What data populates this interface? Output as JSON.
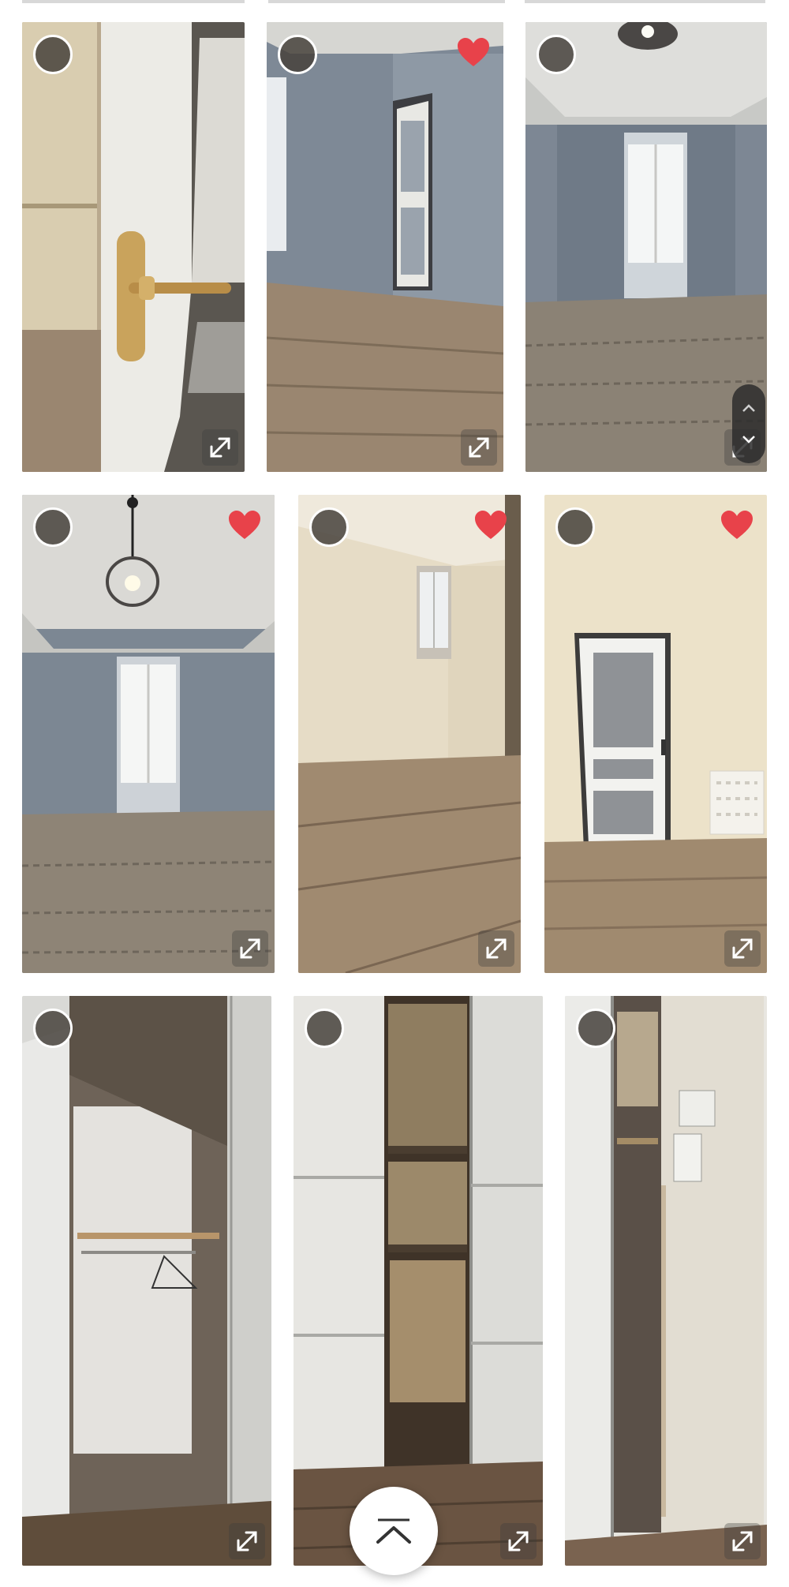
{
  "gallery": {
    "rows": [
      {
        "tiles": [
          {
            "scene": "door-handle",
            "favorited": false
          },
          {
            "scene": "room-door",
            "favorited": true
          },
          {
            "scene": "room-window",
            "favorited": false
          }
        ]
      },
      {
        "tiles": [
          {
            "scene": "room-lamp",
            "favorited": true
          },
          {
            "scene": "room-corner",
            "favorited": true
          },
          {
            "scene": "white-door",
            "favorited": true
          }
        ]
      },
      {
        "tiles": [
          {
            "scene": "closet-shelf",
            "favorited": false
          },
          {
            "scene": "closet-open",
            "favorited": false
          },
          {
            "scene": "closet-narrow",
            "favorited": false
          }
        ]
      }
    ]
  },
  "icons": {
    "select": "selection-circle-icon",
    "favorite": "heart-icon",
    "expand": "expand-arrows-icon",
    "scroll_top": "chevron-up-icon"
  },
  "colors": {
    "favorite": "#e8424a",
    "wall_grey": "#7e8996",
    "floor_wood": "#9a8670",
    "wall_cream": "#e8dcc4"
  }
}
